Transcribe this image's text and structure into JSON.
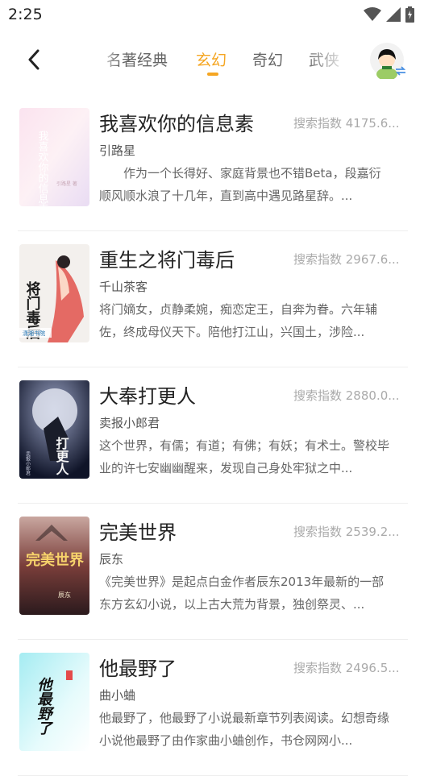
{
  "status": {
    "time": "2:25"
  },
  "nav": {
    "tabs": [
      {
        "label": "名著经典",
        "active": false
      },
      {
        "label": "玄幻",
        "active": true
      },
      {
        "label": "奇幻",
        "active": false
      },
      {
        "label": "武侠",
        "active": false
      }
    ]
  },
  "accent_color": "#f5a623",
  "books": [
    {
      "title": "我喜欢你的信息素",
      "search_index": "搜索指数 4175.6...",
      "author": "引路星",
      "description": "　　作为一个长得好、家庭背景也不错Beta，段嘉衍顺风顺水浪了十几年，直到高中遇见路星辞。...",
      "cover": {
        "text": "我喜欢你的信息素",
        "sub": "引路星 著"
      }
    },
    {
      "title": "重生之将门毒后",
      "search_index": "搜索指数 2967.6...",
      "author": "千山茶客",
      "description": "将门嫡女，贞静柔婉，痴恋定王，自奔为眷。六年辅佐，终成母仪天下。陪他打江山，兴国土，涉险...",
      "cover": {
        "text": "将门毒后",
        "sub": "潇湘书院"
      }
    },
    {
      "title": "大奉打更人",
      "search_index": "搜索指数 2880.0...",
      "author": "卖报小郎君",
      "description": "这个世界，有儒；有道；有佛；有妖；有术士。警校毕业的许七安幽幽醒来，发现自己身处牢狱之中...",
      "cover": {
        "text": "打更人",
        "sub": "卖报小郎君"
      }
    },
    {
      "title": "完美世界",
      "search_index": "搜索指数 2539.2...",
      "author": "辰东",
      "description": "《完美世界》是起点白金作者辰东2013年最新的一部东方玄幻小说，以上古大荒为背景，独创祭灵、...",
      "cover": {
        "text": "完美世界",
        "sub": "辰东"
      }
    },
    {
      "title": "他最野了",
      "search_index": "搜索指数 2496.5...",
      "author": "曲小蛐",
      "description": "他最野了，他最野了小说最新章节列表阅读。幻想奇缘小说他最野了由作家曲小蛐创作，书仓网网小...",
      "cover": {
        "text": "他最野了",
        "sub": ""
      }
    }
  ]
}
